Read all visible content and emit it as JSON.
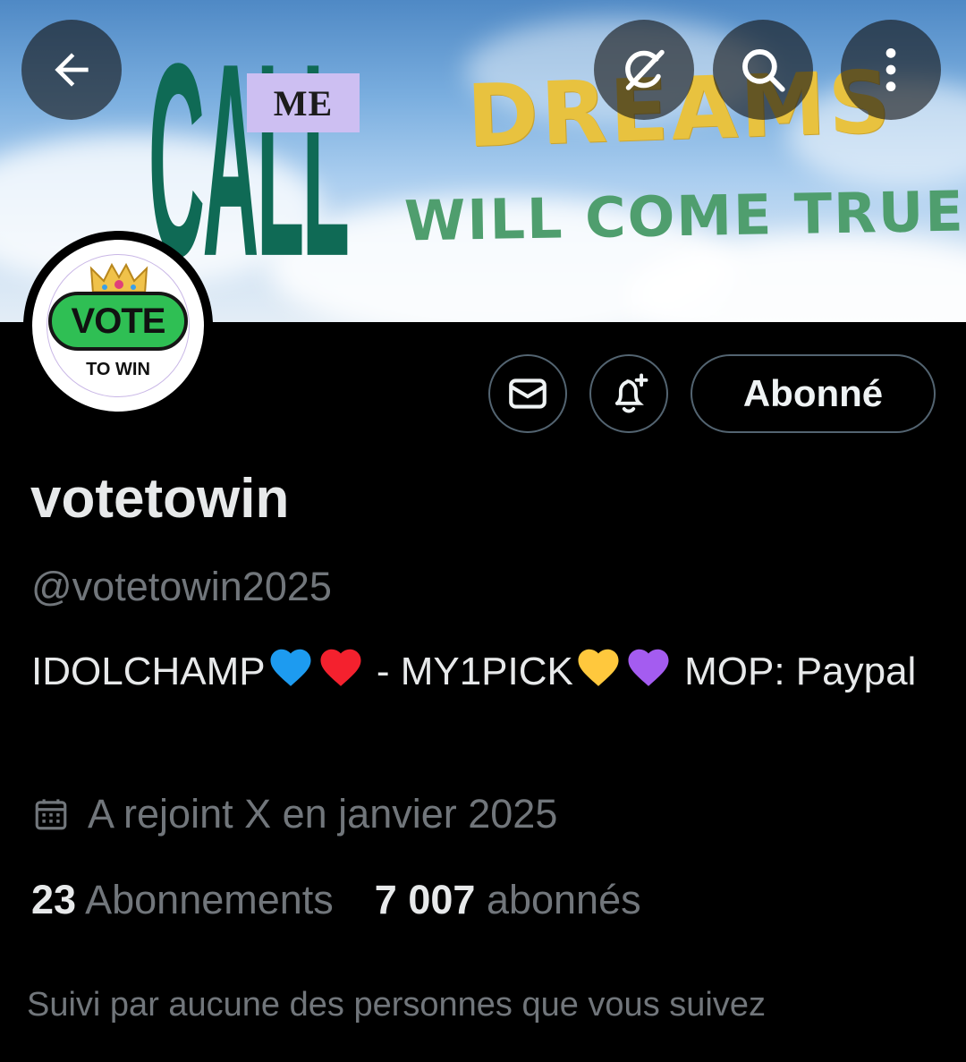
{
  "banner": {
    "word_call": "CALL",
    "word_me": "ME",
    "word_dreams": "DREAMS",
    "word_true": "WILL COME TRUE"
  },
  "nav": {
    "back_icon": "arrow-left-icon",
    "grok_icon": "grok-icon",
    "search_icon": "search-icon",
    "more_icon": "vertical-dots-icon"
  },
  "avatar": {
    "main_text": "VOTE",
    "sub_text": "TO WIN"
  },
  "actions": {
    "message_icon": "envelope-icon",
    "notify_icon": "bell-plus-icon",
    "follow_label": "Abonné"
  },
  "profile": {
    "name": "votetowin",
    "handle": "@votetowin2025",
    "bio_part1": "IDOLCHAMP",
    "bio_part2": " - MY1PICK",
    "bio_part3": " MOP: Paypal",
    "bio_hearts": [
      "blue",
      "red",
      "yellow",
      "purple"
    ],
    "joined": "A rejoint X en janvier 2025",
    "following_count": "23",
    "following_label": "Abonnements",
    "followers_count": "7 007",
    "followers_label": "abonnés",
    "followed_by": "Suivi par aucune des personnes que vous suivez"
  },
  "colors": {
    "background": "#000000",
    "text_primary": "#e7e9ea",
    "text_secondary": "#71767b",
    "border": "#536471",
    "heart_blue": "#1d9bf0",
    "heart_red": "#f4212e",
    "heart_yellow": "#ffc83d",
    "heart_purple": "#a45cf0"
  }
}
